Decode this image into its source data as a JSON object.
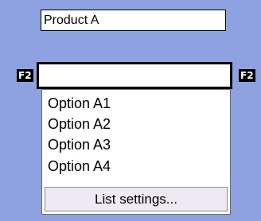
{
  "product_field": {
    "value": "Product A"
  },
  "hotkey": {
    "left": "F2",
    "right": "F2"
  },
  "list_input": {
    "value": ""
  },
  "dropdown": {
    "options": [
      "Option A1",
      "Option A2",
      "Option A3",
      "Option A4"
    ],
    "settings_label": "List settings..."
  },
  "colors": {
    "background": "#8ea2e2",
    "hotkey_background": "#000000",
    "button_background": "#eeeaf4"
  }
}
